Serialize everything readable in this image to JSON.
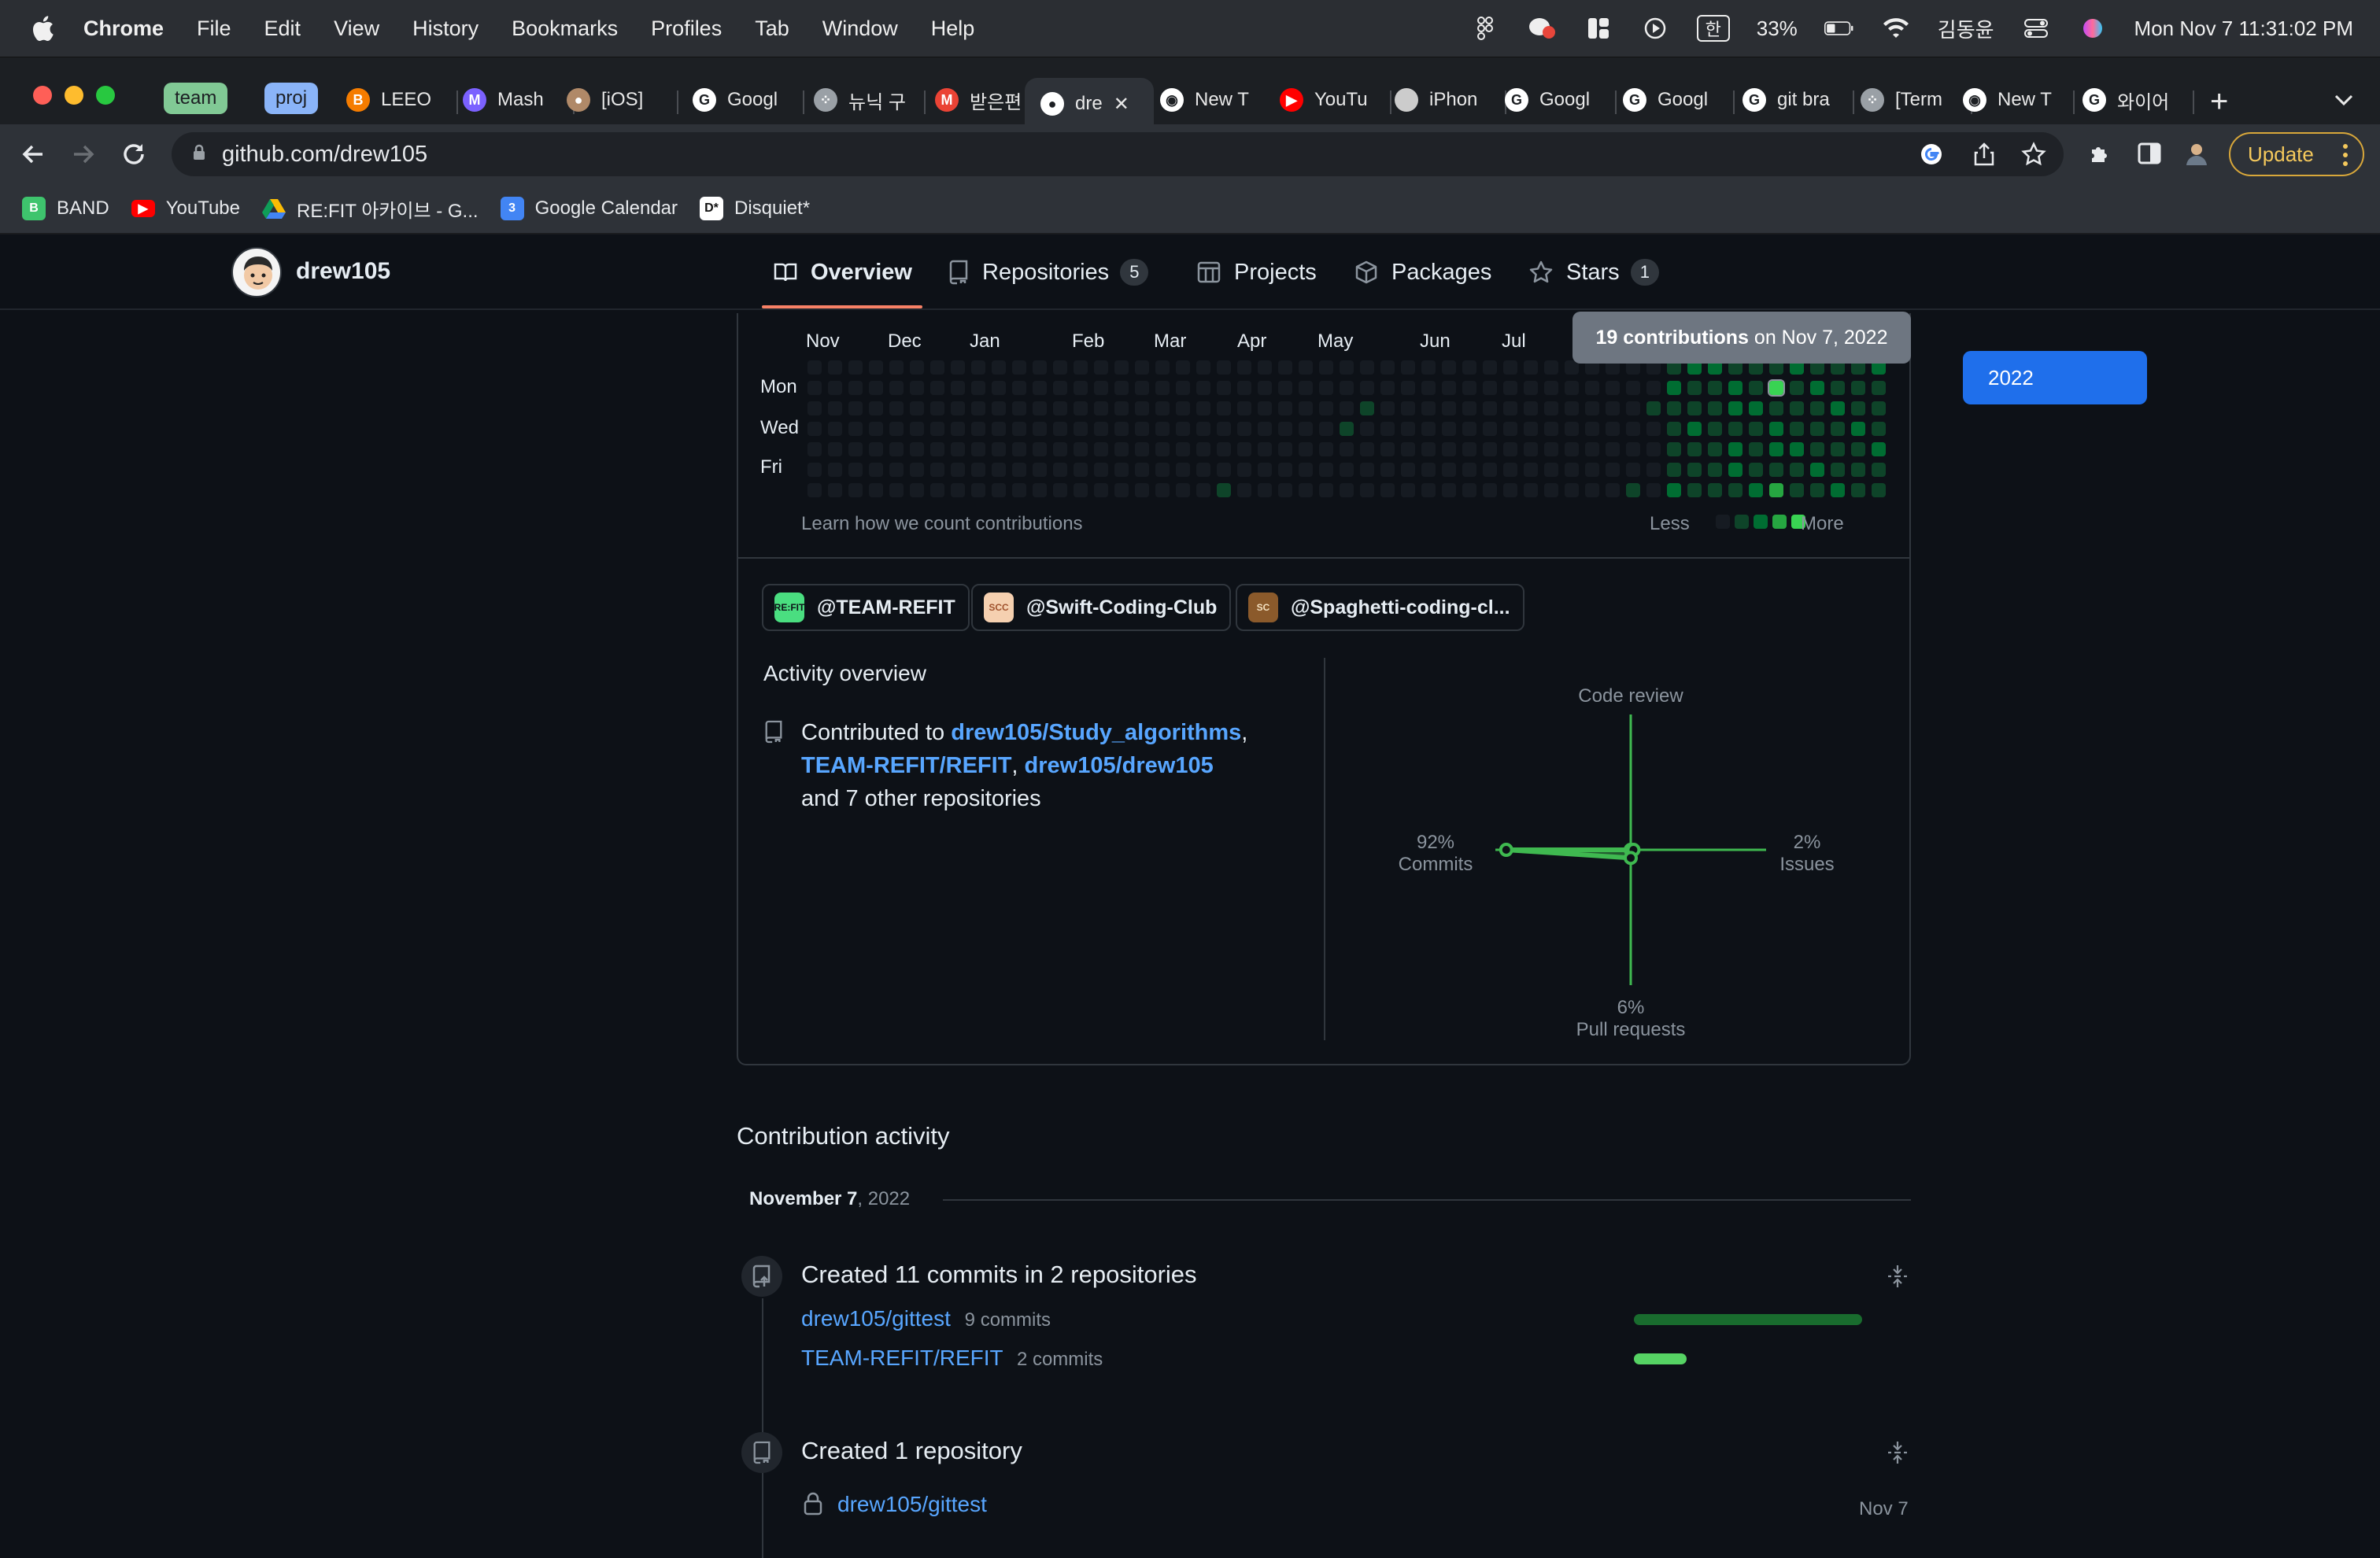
{
  "menubar": {
    "app": "Chrome",
    "items": [
      "File",
      "Edit",
      "View",
      "History",
      "Bookmarks",
      "Profiles",
      "Tab",
      "Window",
      "Help"
    ],
    "input_method": "한",
    "battery": "33%",
    "user": "김동윤",
    "datetime": "Mon Nov 7  11:31:02 PM"
  },
  "tabs": {
    "groups": [
      {
        "label": "team",
        "color": "#81c995"
      },
      {
        "label": "proj",
        "color": "#8ab4f8"
      }
    ],
    "items": [
      {
        "title": "LEEO",
        "icon": "blogger-icon",
        "color": "#f57c00"
      },
      {
        "title": "Mash",
        "icon": "mash-icon",
        "color": "#7b61ff"
      },
      {
        "title": "[iOS]",
        "icon": "avatar-icon",
        "color": "#b08968"
      },
      {
        "title": "Googl",
        "icon": "google-icon",
        "color": "#ffffff"
      },
      {
        "title": "뉴닉 구",
        "icon": "dots-icon",
        "color": "#9aa0a6"
      },
      {
        "title": "받은편",
        "icon": "gmail-icon",
        "color": "#ea4335"
      },
      {
        "title": "dre",
        "icon": "github-icon",
        "color": "#ffffff"
      },
      {
        "title": "New T",
        "icon": "chrome-icon",
        "color": "#ffffff"
      },
      {
        "title": "YouTu",
        "icon": "youtube-icon",
        "color": "#ff0000"
      },
      {
        "title": "iPhon",
        "icon": "apple-icon",
        "color": "#cccccc"
      },
      {
        "title": "Googl",
        "icon": "google-icon",
        "color": "#ffffff"
      },
      {
        "title": "Googl",
        "icon": "google-icon",
        "color": "#ffffff"
      },
      {
        "title": "git bra",
        "icon": "google-icon",
        "color": "#ffffff"
      },
      {
        "title": "[Term",
        "icon": "dots-icon",
        "color": "#9aa0a6"
      },
      {
        "title": "New T",
        "icon": "chrome-icon",
        "color": "#ffffff"
      },
      {
        "title": "와이어",
        "icon": "google-icon",
        "color": "#ffffff"
      }
    ],
    "new_tab": "+"
  },
  "address": {
    "url": "github.com/drew105",
    "update_label": "Update"
  },
  "bookmarks": [
    {
      "label": "BAND",
      "icon": "band-icon",
      "color": "#3ec46d"
    },
    {
      "label": "YouTube",
      "icon": "youtube-icon",
      "color": "#ff0000"
    },
    {
      "label": "RE:FIT 아카이브 - G...",
      "icon": "drive-icon",
      "color": "#fbbc04"
    },
    {
      "label": "Google Calendar",
      "icon": "calendar-icon",
      "color": "#4285f4"
    },
    {
      "label": "Disquiet*",
      "icon": "disquiet-icon",
      "color": "#ffffff"
    }
  ],
  "profile": {
    "username": "drew105",
    "nav": [
      {
        "label": "Overview",
        "count": null
      },
      {
        "label": "Repositories",
        "count": "5"
      },
      {
        "label": "Projects",
        "count": null
      },
      {
        "label": "Packages",
        "count": null
      },
      {
        "label": "Stars",
        "count": "1"
      }
    ]
  },
  "contrib_graph": {
    "months": [
      "Nov",
      "Dec",
      "Jan",
      "Feb",
      "Mar",
      "Apr",
      "May",
      "Jun",
      "Jul"
    ],
    "days": [
      "Mon",
      "Wed",
      "Fri"
    ],
    "tooltip_strong": "19 contributions",
    "tooltip_rest": " on Nov 7, 2022",
    "learn_link": "Learn how we count contributions",
    "less": "Less",
    "more": "More",
    "level_colors": [
      "#161b22",
      "#0e4429",
      "#006d32",
      "#26a641",
      "#39d353"
    ]
  },
  "year_selector": {
    "selected": "2022"
  },
  "orgs": [
    {
      "label": "@TEAM-REFIT",
      "color": "#4ade80",
      "text": "RE:FIT"
    },
    {
      "label": "@Swift-Coding-Club",
      "color": "#f5d0b0",
      "text": "SCC"
    },
    {
      "label": "@Spaghetti-coding-cl...",
      "color": "#8b5a2b",
      "text": "SC"
    }
  ],
  "activity_overview": {
    "heading": "Activity overview",
    "contributed_to": "Contributed to",
    "repo1": "drew105/Study_algorithms",
    "comma1": ",",
    "repo2": "TEAM-REFIT/REFIT",
    "comma2": ",",
    "repo3": "drew105/drew105",
    "others": "and 7 other repositories"
  },
  "chart_data": {
    "type": "scatter",
    "title": "",
    "axes": [
      {
        "label": "Code review",
        "value": 0,
        "pct": ""
      },
      {
        "label": "Issues",
        "value": 2,
        "pct": "2%"
      },
      {
        "label": "Pull requests",
        "value": 6,
        "pct": "6%"
      },
      {
        "label": "Commits",
        "value": 92,
        "pct": "92%"
      }
    ],
    "color": "#3fb950"
  },
  "contribution_activity": {
    "heading": "Contribution activity",
    "month_bold": "November 7",
    "month_rest": ", 2022",
    "commits_title": "Created 11 commits in 2 repositories",
    "commit_repos": [
      {
        "name": "drew105/gittest",
        "count": "9 commits",
        "fraction": 1.0
      },
      {
        "name": "TEAM-REFIT/REFIT",
        "count": "2 commits",
        "fraction": 0.23
      }
    ],
    "repo_title": "Created 1 repository",
    "created_repo": "drew105/gittest",
    "created_date": "Nov 7"
  }
}
